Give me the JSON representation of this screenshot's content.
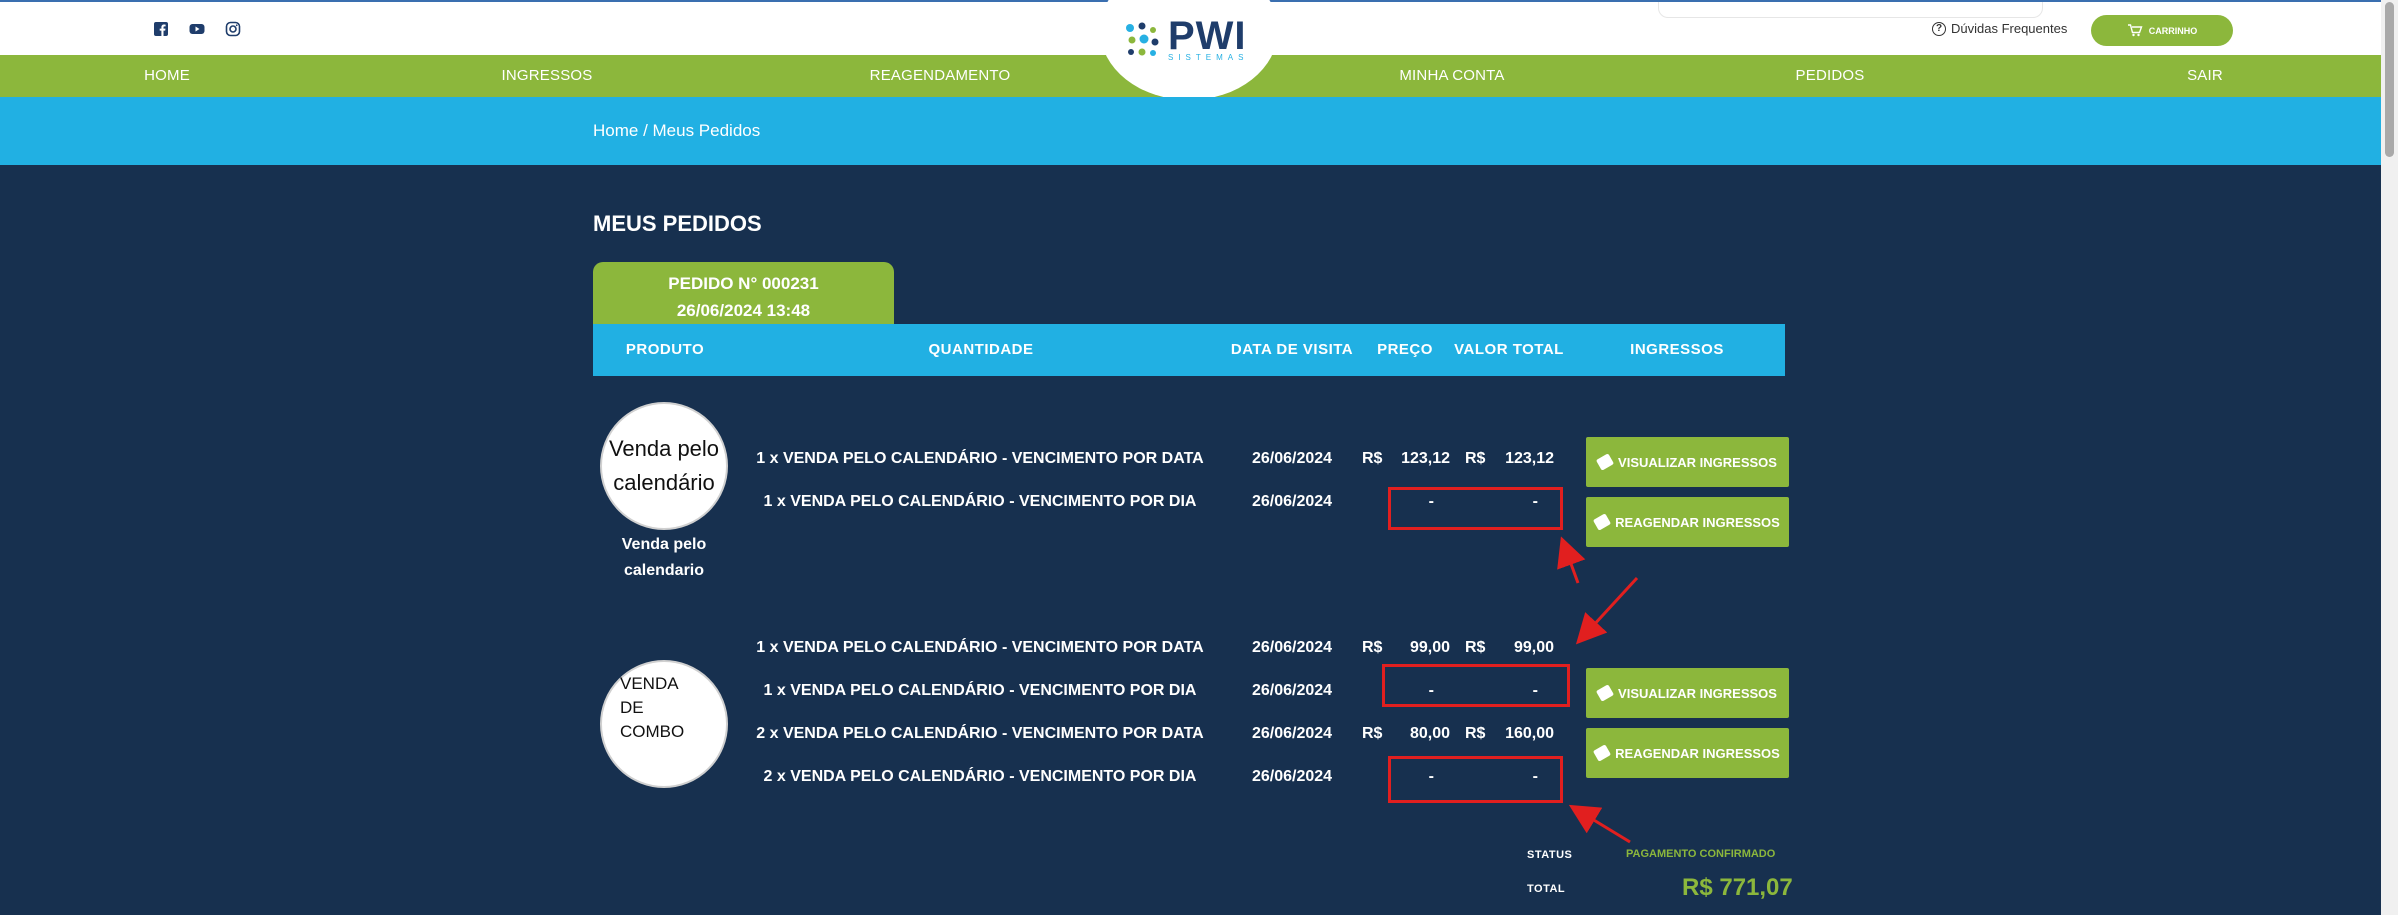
{
  "header": {
    "social": [
      "facebook-icon",
      "youtube-icon",
      "instagram-icon"
    ],
    "faq_label": "Dúvidas Frequentes",
    "cart_label": "CARRINHO",
    "logo_text": "PWI",
    "logo_sub": "SISTEMAS"
  },
  "nav": {
    "items": [
      "HOME",
      "INGRESSOS",
      "REAGENDAMENTO",
      "MINHA CONTA",
      "PEDIDOS",
      "SAIR"
    ]
  },
  "breadcrumb": "Home / Meus Pedidos",
  "page_title": "MEUS PEDIDOS",
  "order": {
    "number": "PEDIDO N° 000231",
    "datetime": "26/06/2024 13:48",
    "columns": [
      "PRODUTO",
      "QUANTIDADE",
      "DATA DE VISITA",
      "PREÇO",
      "VALOR TOTAL",
      "INGRESSOS"
    ],
    "groups": [
      {
        "image_text": "Venda pelo calendário",
        "name_line1": "Venda pelo",
        "name_line2": "calendario",
        "rows": [
          {
            "desc": "1 x VENDA PELO CALENDÁRIO - VENCIMENTO POR DATA",
            "date": "26/06/2024",
            "currency1": "R$",
            "price": "123,12",
            "currency2": "R$",
            "total": "123,12"
          },
          {
            "desc": "1 x VENDA PELO CALENDÁRIO - VENCIMENTO POR DIA",
            "date": "26/06/2024",
            "currency1": "",
            "price": "-",
            "currency2": "",
            "total": "-"
          }
        ],
        "view_btn": "VISUALIZAR INGRESSOS",
        "reschedule_btn": "REAGENDAR INGRESSOS"
      },
      {
        "image_line1": "VENDA",
        "image_line2": "DE",
        "image_line3": "COMBO",
        "rows": [
          {
            "desc": "1 x VENDA PELO CALENDÁRIO - VENCIMENTO POR DATA",
            "date": "26/06/2024",
            "currency1": "R$",
            "price": "99,00",
            "currency2": "R$",
            "total": "99,00"
          },
          {
            "desc": "1 x VENDA PELO CALENDÁRIO - VENCIMENTO POR DIA",
            "date": "26/06/2024",
            "currency1": "",
            "price": "-",
            "currency2": "",
            "total": "-"
          },
          {
            "desc": "2 x VENDA PELO CALENDÁRIO - VENCIMENTO POR DATA",
            "date": "26/06/2024",
            "currency1": "R$",
            "price": "80,00",
            "currency2": "R$",
            "total": "160,00"
          },
          {
            "desc": "2 x VENDA PELO CALENDÁRIO - VENCIMENTO POR DIA",
            "date": "26/06/2024",
            "currency1": "",
            "price": "-",
            "currency2": "",
            "total": "-"
          }
        ],
        "view_btn": "VISUALIZAR INGRESSOS",
        "reschedule_btn": "REAGENDAR INGRESSOS"
      }
    ],
    "status_label": "STATUS",
    "status_value": "PAGAMENTO CONFIRMADO",
    "total_label": "TOTAL",
    "total_value": "R$ 771,07"
  },
  "colors": {
    "green": "#8cb73c",
    "blue": "#21b0e3",
    "navy": "#17304f",
    "annotation_red": "#e11f1f"
  }
}
